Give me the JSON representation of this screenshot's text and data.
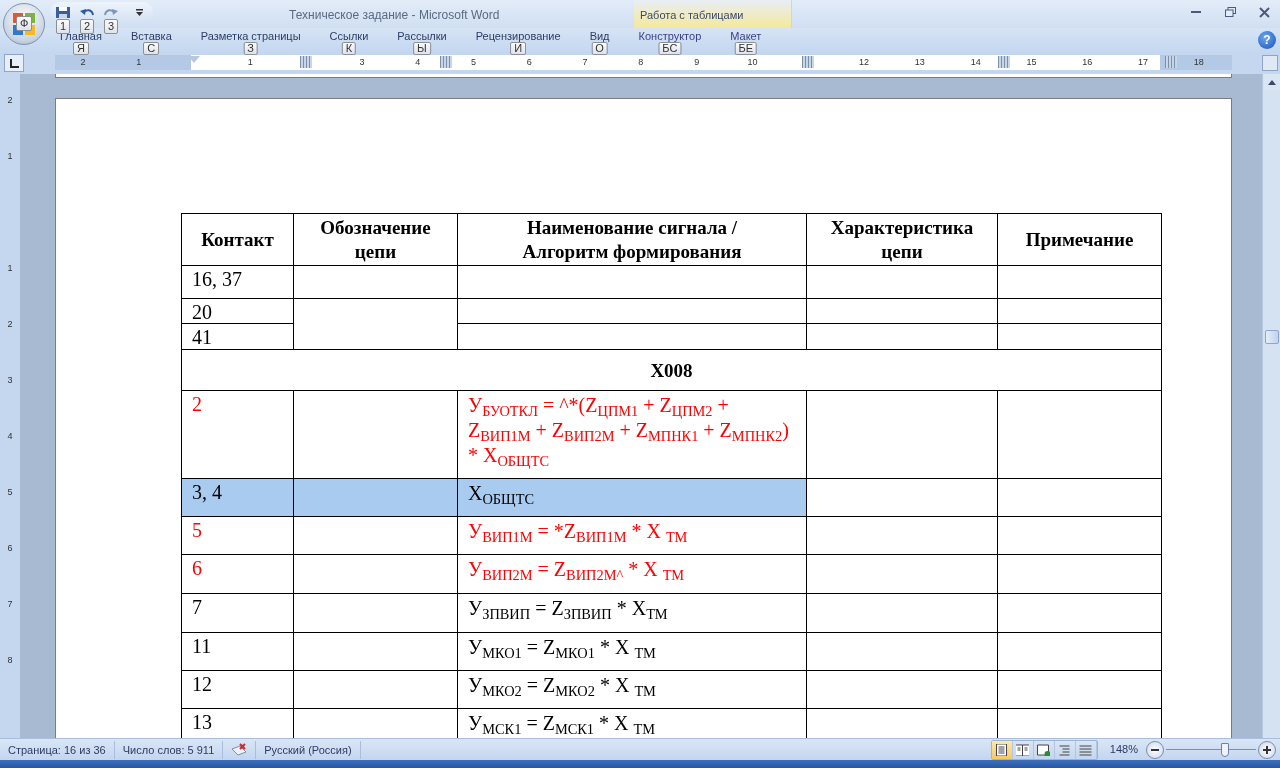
{
  "office_button": {
    "keytip": "Ф"
  },
  "quick_access": [
    {
      "kind": "save",
      "keytip": "1"
    },
    {
      "kind": "undo",
      "keytip": "2"
    },
    {
      "kind": "redo",
      "keytip": "3"
    }
  ],
  "window": {
    "title": "Техническое задание - Microsoft Word",
    "context_group": "Работа с таблицами"
  },
  "ribbon_tabs": [
    {
      "label": "Главная",
      "keytip": "Я",
      "contextual": false
    },
    {
      "label": "Вставка",
      "keytip": "С",
      "contextual": false
    },
    {
      "label": "Разметка страницы",
      "keytip": "З",
      "contextual": false
    },
    {
      "label": "Ссылки",
      "keytip": "К",
      "contextual": false
    },
    {
      "label": "Рассылки",
      "keytip": "Ы",
      "contextual": false
    },
    {
      "label": "Рецензирование",
      "keytip": "И",
      "contextual": false
    },
    {
      "label": "Вид",
      "keytip": "О",
      "contextual": false
    },
    {
      "label": "Конструктор",
      "keytip": "БС",
      "contextual": true
    },
    {
      "label": "Макет",
      "keytip": "БЕ",
      "contextual": true
    }
  ],
  "help_button": "?",
  "horizontal_ruler": [
    {
      "kind": "number",
      "label": "2"
    },
    {
      "kind": "number",
      "label": "1"
    },
    {
      "kind": "indent"
    },
    {
      "kind": "number",
      "label": "1"
    },
    {
      "kind": "column"
    },
    {
      "kind": "number",
      "label": "3"
    },
    {
      "kind": "number",
      "label": "4"
    },
    {
      "kind": "column-edge"
    },
    {
      "kind": "number",
      "label": "5"
    },
    {
      "kind": "number",
      "label": "6"
    },
    {
      "kind": "number",
      "label": "7"
    },
    {
      "kind": "number",
      "label": "8"
    },
    {
      "kind": "number",
      "label": "9"
    },
    {
      "kind": "number",
      "label": "10"
    },
    {
      "kind": "column"
    },
    {
      "kind": "number",
      "label": "12"
    },
    {
      "kind": "number",
      "label": "13"
    },
    {
      "kind": "number",
      "label": "14"
    },
    {
      "kind": "column-edge"
    },
    {
      "kind": "number",
      "label": "15"
    },
    {
      "kind": "number",
      "label": "16"
    },
    {
      "kind": "number",
      "label": "17"
    },
    {
      "kind": "column-edge"
    },
    {
      "kind": "number",
      "label": "18"
    }
  ],
  "vertical_ruler": [
    {
      "kind": "number",
      "label": "2"
    },
    {
      "kind": "number",
      "label": "1"
    },
    {
      "kind": "margin"
    },
    {
      "kind": "number",
      "label": "1"
    },
    {
      "kind": "number",
      "label": "2"
    },
    {
      "kind": "number",
      "label": "3"
    },
    {
      "kind": "number",
      "label": "4"
    },
    {
      "kind": "number",
      "label": "5"
    },
    {
      "kind": "number",
      "label": "6"
    },
    {
      "kind": "number",
      "label": "7"
    },
    {
      "kind": "number",
      "label": "8"
    }
  ],
  "table": {
    "columns": [
      "Контакт",
      "Обозначение\nцепи",
      "Наименование сигнала /\nАлгоритм формирования",
      "Характеристика\nцепи",
      "Примечание"
    ],
    "rows": [
      {
        "kind": "data",
        "contact": "16, 37",
        "signal": "",
        "color": "#000000",
        "selected": false
      },
      {
        "kind": "data",
        "contact": "20",
        "signal": "",
        "color": "#000000",
        "selected": false,
        "merge_circuit_with_next": true
      },
      {
        "kind": "data",
        "contact": "41",
        "signal": "",
        "color": "#000000",
        "selected": false
      },
      {
        "kind": "section",
        "title": "Х008"
      },
      {
        "kind": "data",
        "contact": "2",
        "signal": "У$_{БУОТКЛ}$ = ^*(Z$_{ЦПМ1}$ + Z$_{ЦПМ2}$ + Z$_{ВИП1М}$ + Z$_{ВИП2М}$ + Z$_{МПНК1}$ + Z$_{МПНК2}$) * Х$_{ОБЩТС}$",
        "color": "#ff0000",
        "selected": false
      },
      {
        "kind": "data",
        "contact": "3, 4",
        "signal": "Х$_{ОБЩТС}$",
        "color": "#000000",
        "selected": true
      },
      {
        "kind": "data",
        "contact": "5",
        "signal": "У$_{ВИП1М}$ = *Z$_{ВИП1М}$ * Х $_{ТМ}$",
        "color": "#ff0000",
        "selected": false
      },
      {
        "kind": "data",
        "contact": "6",
        "signal": "У$_{ВИП2М}$ = Z$_{ВИП2М^}$ * Х $_{ТМ}$",
        "color": "#ff0000",
        "selected": false
      },
      {
        "kind": "data",
        "contact": "7",
        "signal": "У$_{ЗПВИП}$ = Z$_{ЗПВИП}$ * Х$_{ТМ}$",
        "color": "#000000",
        "selected": false
      },
      {
        "kind": "data",
        "contact": "11",
        "signal": "У$_{МКО1}$ = Z$_{МКО1}$ * Х $_{ТМ}$",
        "color": "#000000",
        "selected": false
      },
      {
        "kind": "data",
        "contact": "12",
        "signal": "У$_{МКО2}$ = Z$_{МКО2}$ * Х $_{ТМ}$",
        "color": "#000000",
        "selected": false
      },
      {
        "kind": "data",
        "contact": "13",
        "signal": "У$_{МСК1}$ = Z$_{МСК1}$ * Х $_{ТМ}$",
        "color": "#000000",
        "selected": false
      }
    ]
  },
  "status_bar": {
    "page": "Страница: 16 из 36",
    "words": "Число слов: 5 911",
    "language": "Русский (Россия)",
    "zoom": "148%",
    "zoom_slider": {
      "level": 0.65
    },
    "views": [
      {
        "kind": "print-layout",
        "selected": true
      },
      {
        "kind": "reading",
        "selected": false
      },
      {
        "kind": "web",
        "selected": false
      },
      {
        "kind": "outline",
        "selected": false
      },
      {
        "kind": "draft",
        "selected": false
      }
    ]
  }
}
